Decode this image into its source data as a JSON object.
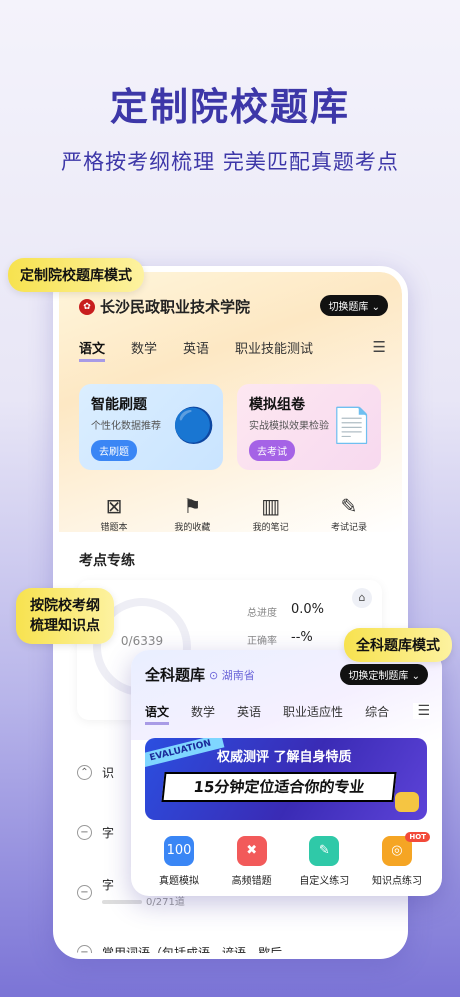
{
  "header": {
    "title": "定制院校题库",
    "subtitle": "严格按考纲梳理 完美匹配真题考点"
  },
  "callouts": {
    "custom_mode": "定制院校题库模式",
    "outline": "按院校考纲梳理知识点",
    "outline_line1": "按院校考纲",
    "outline_line2": "梳理知识点",
    "all_mode": "全科题库模式"
  },
  "school": {
    "name": "长沙民政职业技术学院",
    "switch_label": "切换题库"
  },
  "tabs": [
    {
      "label": "语文"
    },
    {
      "label": "数学"
    },
    {
      "label": "英语"
    },
    {
      "label": "职业技能测试"
    }
  ],
  "cards": {
    "smart": {
      "title": "智能刷题",
      "desc": "个性化数据推荐",
      "button": "去刷题"
    },
    "mock": {
      "title": "模拟组卷",
      "desc": "实战模拟效果检验",
      "button": "去考试"
    }
  },
  "quick_links": [
    {
      "label": "错题本",
      "icon": "wrong-book-icon"
    },
    {
      "label": "我的收藏",
      "icon": "bookmark-icon"
    },
    {
      "label": "我的笔记",
      "icon": "notebook-icon"
    },
    {
      "label": "考试记录",
      "icon": "exam-record-icon"
    }
  ],
  "practice": {
    "title": "考点专练",
    "progress_text": "0/6339",
    "progress_label": "总进度",
    "progress_value": "0.0%",
    "accuracy_label": "正确率",
    "accuracy_value": "--%"
  },
  "list": [
    {
      "title": "识",
      "sub": ""
    },
    {
      "title": "字",
      "sub": ""
    },
    {
      "title": "字",
      "sub": "0/271道"
    },
    {
      "title": "常用词语（包括成语、谚语、歇后",
      "sub": ""
    }
  ],
  "overlay": {
    "title": "全科题库",
    "location": "湖南省",
    "switch_label": "切换定制题库",
    "tabs": [
      {
        "label": "语文"
      },
      {
        "label": "数学"
      },
      {
        "label": "英语"
      },
      {
        "label": "职业适应性"
      },
      {
        "label": "综合"
      }
    ],
    "banner": {
      "tag": "EVALUATION",
      "line1": "权威测评 了解自身特质",
      "line2": "15分钟定位适合你的专业"
    },
    "grid": [
      {
        "label": "真题模拟",
        "color": "#3a86f5",
        "icon_text": "100"
      },
      {
        "label": "高频错题",
        "color": "#f25a5a",
        "icon_text": "✖"
      },
      {
        "label": "自定义练习",
        "color": "#2fc9a8",
        "icon_text": "✎"
      },
      {
        "label": "知识点练习",
        "color": "#f5a524",
        "icon_text": "◎"
      }
    ],
    "hot_badge": "HOT"
  }
}
